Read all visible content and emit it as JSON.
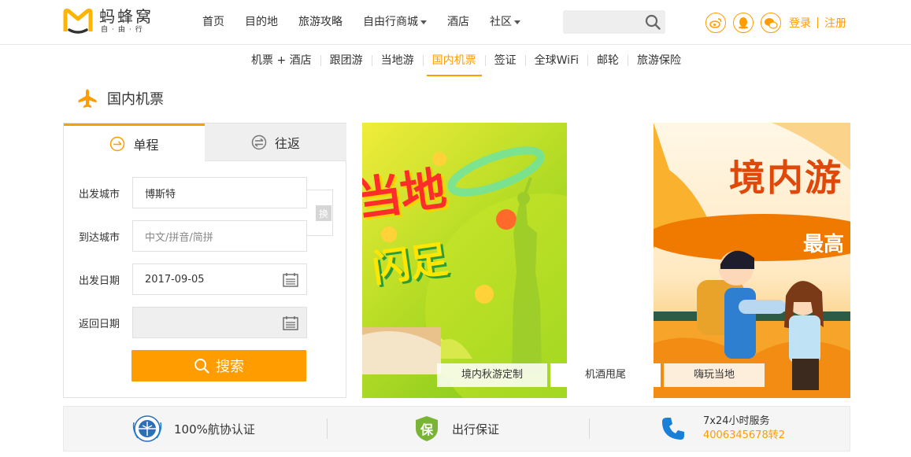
{
  "header": {
    "logo_title": "蚂蜂窝",
    "logo_sub": "自·由·行",
    "nav": [
      "首页",
      "目的地",
      "旅游攻略",
      "自由行商城",
      "酒店",
      "社区"
    ],
    "search_placeholder": "",
    "login": "登录",
    "register": "注册"
  },
  "subnav": [
    "机票 + 酒店",
    "跟团游",
    "当地游",
    "国内机票",
    "签证",
    "全球WiFi",
    "邮轮",
    "旅游保险"
  ],
  "page_title": "国内机票",
  "form": {
    "tab_oneway": "单程",
    "tab_round": "往返",
    "depart_city_label": "出发城市",
    "depart_city_value": "博斯特",
    "arrive_city_label": "到达城市",
    "arrive_city_placeholder": "中文/拼音/简拼",
    "depart_date_label": "出发日期",
    "depart_date_value": "2017-09-05",
    "return_date_label": "返回日期",
    "return_date_value": "",
    "swap_label": "换",
    "search_button": "搜索"
  },
  "banners": {
    "b1_text_a": "当地",
    "b1_text_b": "闪足",
    "b2_headline": "境内游",
    "b2_badge": "最高",
    "captions": [
      "境内秋游定制",
      "机酒甩尾",
      "嗨玩当地"
    ]
  },
  "footer": {
    "cert": "100%航协认证",
    "guarantee_icon_text": "保",
    "guarantee": "出行保证",
    "service_hours": "7x24小时服务",
    "service_phone": "4006345678转2"
  },
  "colors": {
    "accent": "#ff9d00",
    "link_blue": "#1a7fd6",
    "banner_green": "#9ad223",
    "banner_orange": "#f08a00"
  }
}
